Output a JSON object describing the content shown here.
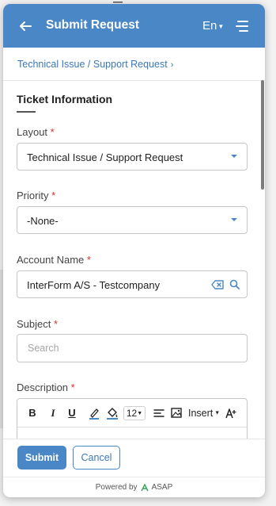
{
  "header": {
    "title": "Submit Request",
    "language": "En",
    "colors": {
      "bar": "#4a87c6",
      "text": "#ffffff"
    }
  },
  "breadcrumb": {
    "label": "Technical Issue / Support Request"
  },
  "section": {
    "title": "Ticket Information"
  },
  "fields": {
    "layout": {
      "label": "Layout",
      "required_mark": "*",
      "value": "Technical Issue / Support Request"
    },
    "priority": {
      "label": "Priority",
      "required_mark": "*",
      "value": "-None-"
    },
    "account": {
      "label": "Account Name",
      "required_mark": "*",
      "value": "InterForm A/S - Testcompany"
    },
    "subject": {
      "label": "Subject",
      "required_mark": "*",
      "placeholder": "Search"
    },
    "description": {
      "label": "Description",
      "required_mark": "*"
    }
  },
  "editor": {
    "bold": "B",
    "italic": "I",
    "underline": "U",
    "font_size": "12",
    "insert": "Insert"
  },
  "footer": {
    "submit": "Submit",
    "cancel": "Cancel",
    "powered_by": "Powered by",
    "brand": "ASAP"
  },
  "icons": [
    "back-arrow-icon",
    "chevron-down-icon",
    "hamburger-menu-icon",
    "chevron-right-icon",
    "clear-icon",
    "search-icon",
    "pen-icon",
    "paint-bucket-icon",
    "align-icon",
    "image-icon",
    "font-size-icon",
    "asap-logo-icon"
  ],
  "colors": {
    "accent": "#4a87c6",
    "required": "#d9302c",
    "link": "#3b78b8"
  }
}
